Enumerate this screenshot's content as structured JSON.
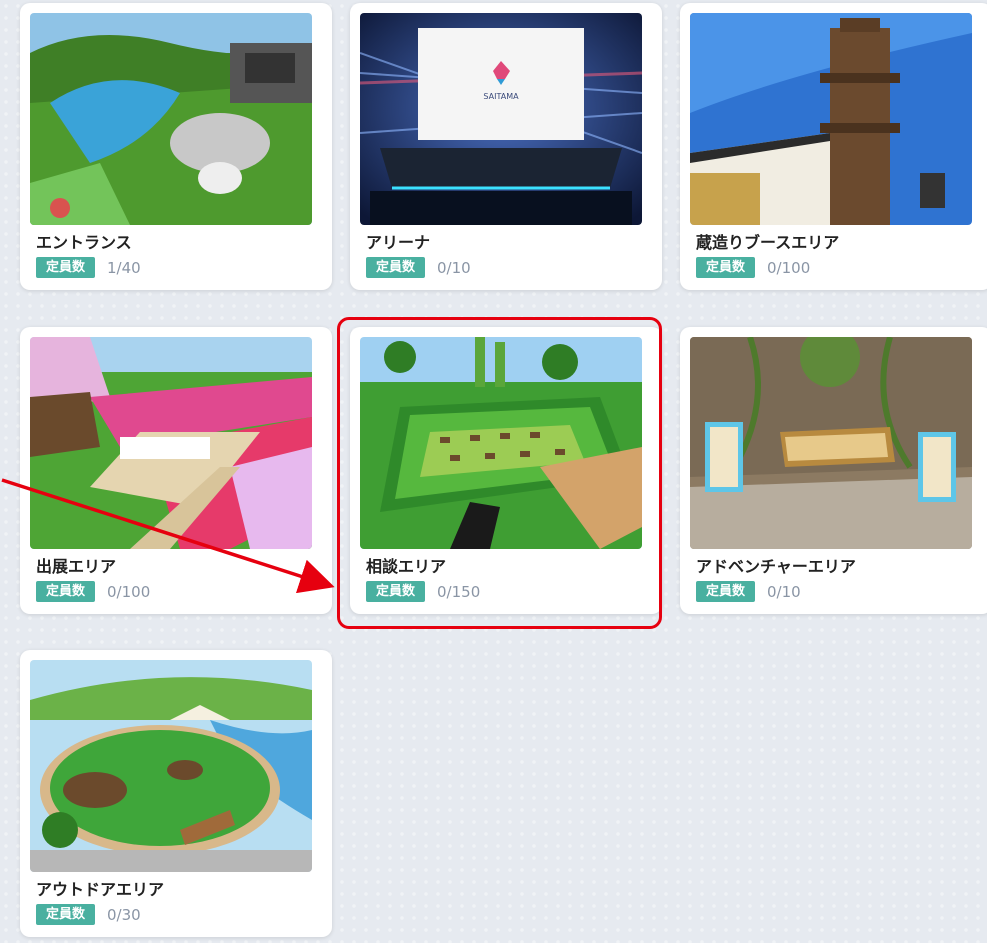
{
  "rooms": [
    {
      "name": "エントランス",
      "capacity_label": "定員数",
      "capacity": "1/40"
    },
    {
      "name": "アリーナ",
      "capacity_label": "定員数",
      "capacity": "0/10",
      "screen_logo": "SAITAMA"
    },
    {
      "name": "蔵造りブースエリア",
      "capacity_label": "定員数",
      "capacity": "0/100"
    },
    {
      "name": "出展エリア",
      "capacity_label": "定員数",
      "capacity": "0/100"
    },
    {
      "name": "相談エリア",
      "capacity_label": "定員数",
      "capacity": "0/150"
    },
    {
      "name": "アドベンチャーエリア",
      "capacity_label": "定員数",
      "capacity": "0/10"
    },
    {
      "name": "アウトドアエリア",
      "capacity_label": "定員数",
      "capacity": "0/30"
    }
  ],
  "highlight": {
    "color": "#e6000f",
    "target": "相談エリア"
  },
  "colors": {
    "badge": "#49b0a0",
    "background": "#e6eaf0"
  }
}
